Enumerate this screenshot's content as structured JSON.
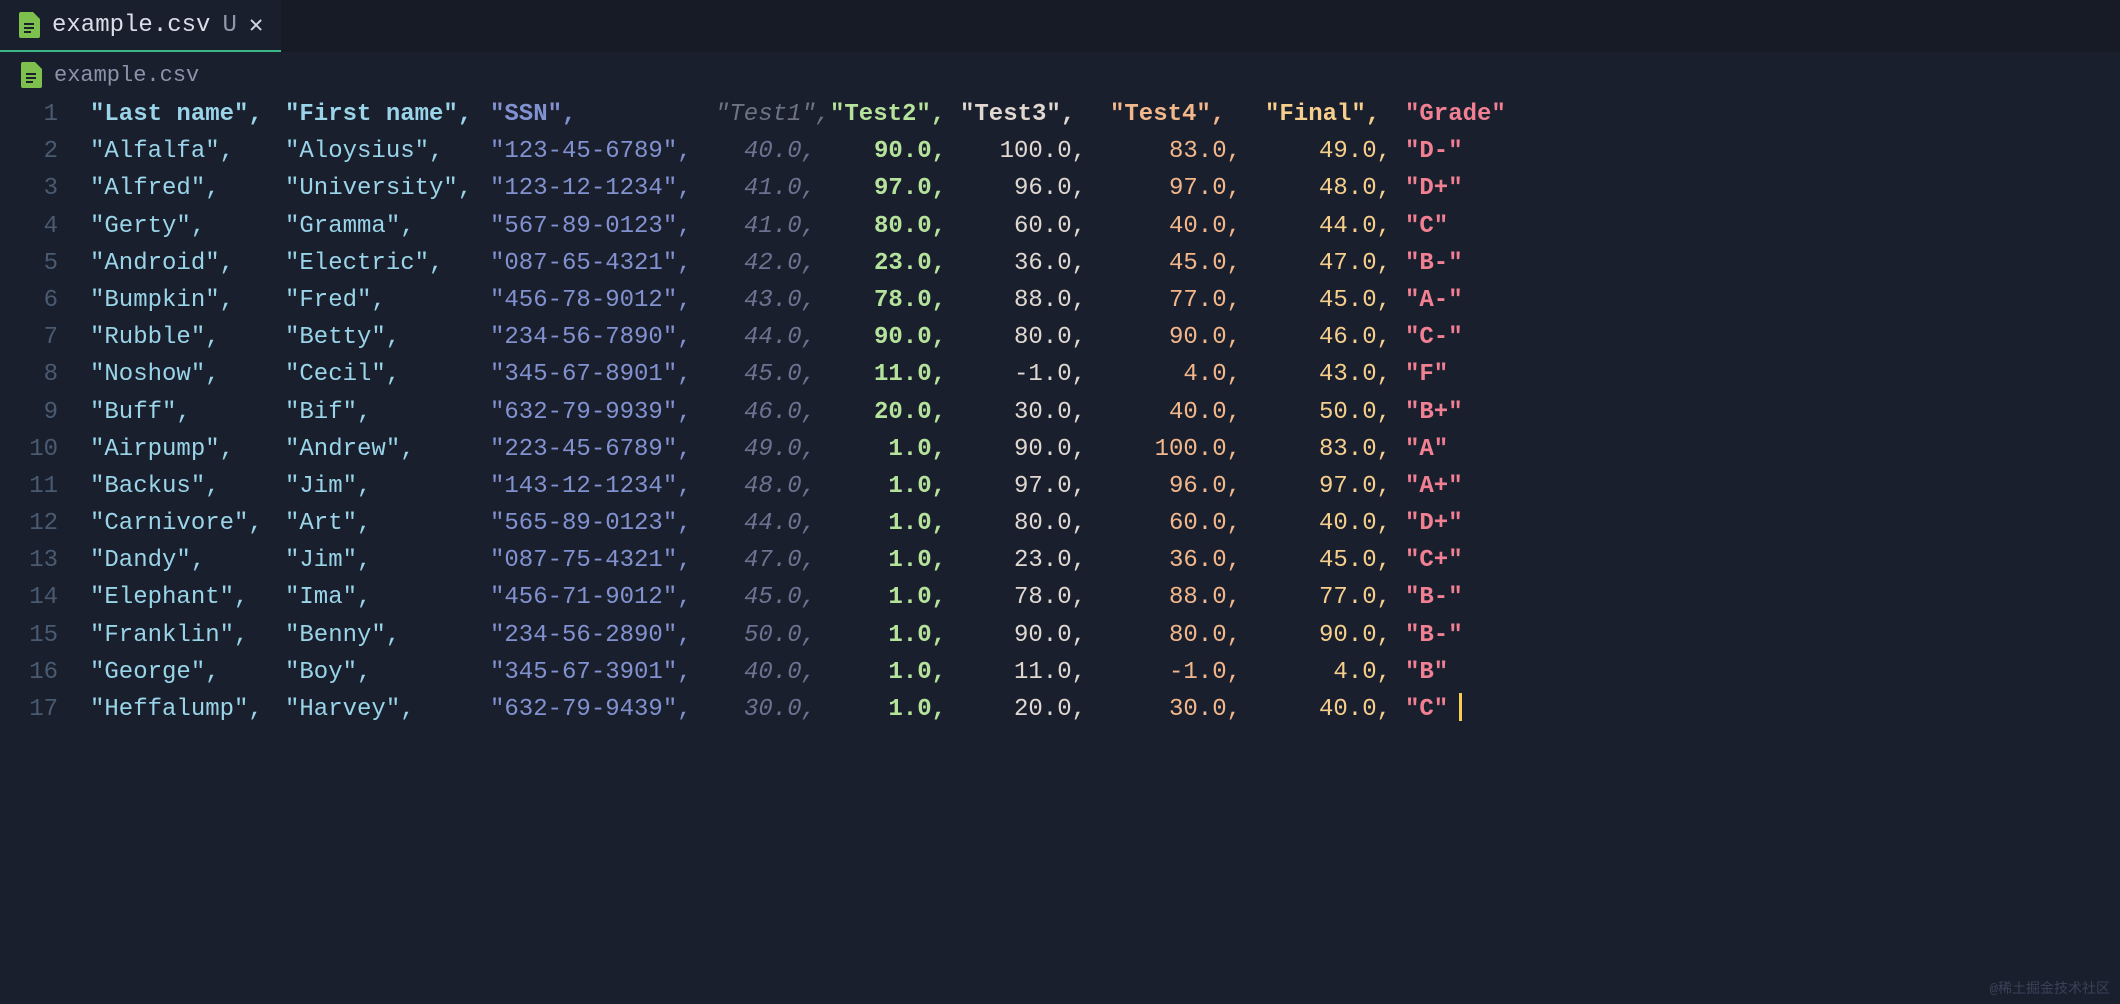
{
  "tab": {
    "title": "example.csv",
    "modified_indicator": "U",
    "close_glyph": "✕"
  },
  "breadcrumb": {
    "file": "example.csv"
  },
  "columns": [
    {
      "label": "\"Last name\",",
      "class": "c1",
      "w": "w1"
    },
    {
      "label": "\"First name\",",
      "class": "c2",
      "w": "w2"
    },
    {
      "label": "\"SSN\",",
      "class": "c3",
      "w": "w3"
    },
    {
      "label": "\"Test1\",",
      "class": "c4h",
      "w": "wh4"
    },
    {
      "label": "\"Test2\",",
      "class": "c5",
      "w": "wh5"
    },
    {
      "label": "\"Test3\",",
      "class": "c6",
      "w": "wh6"
    },
    {
      "label": "\"Test4\",",
      "class": "c7",
      "w": "wh7"
    },
    {
      "label": "\"Final\",",
      "class": "c8",
      "w": "wh8"
    },
    {
      "label": "\"Grade\"",
      "class": "c9",
      "w": "w9"
    }
  ],
  "rows": [
    {
      "last": "\"Alfalfa\",",
      "first": "\"Aloysius\",",
      "ssn": "\"123-45-6789\",",
      "t1": "40.0,",
      "t2": "90.0,",
      "t3": "100.0,",
      "t4": "83.0,",
      "fin": "49.0,",
      "gr": "\"D-\""
    },
    {
      "last": "\"Alfred\",",
      "first": "\"University\",",
      "ssn": "\"123-12-1234\",",
      "t1": "41.0,",
      "t2": "97.0,",
      "t3": "96.0,",
      "t4": "97.0,",
      "fin": "48.0,",
      "gr": "\"D+\""
    },
    {
      "last": "\"Gerty\",",
      "first": "\"Gramma\",",
      "ssn": "\"567-89-0123\",",
      "t1": "41.0,",
      "t2": "80.0,",
      "t3": "60.0,",
      "t4": "40.0,",
      "fin": "44.0,",
      "gr": "\"C\""
    },
    {
      "last": "\"Android\",",
      "first": "\"Electric\",",
      "ssn": "\"087-65-4321\",",
      "t1": "42.0,",
      "t2": "23.0,",
      "t3": "36.0,",
      "t4": "45.0,",
      "fin": "47.0,",
      "gr": "\"B-\""
    },
    {
      "last": "\"Bumpkin\",",
      "first": "\"Fred\",",
      "ssn": "\"456-78-9012\",",
      "t1": "43.0,",
      "t2": "78.0,",
      "t3": "88.0,",
      "t4": "77.0,",
      "fin": "45.0,",
      "gr": "\"A-\""
    },
    {
      "last": "\"Rubble\",",
      "first": "\"Betty\",",
      "ssn": "\"234-56-7890\",",
      "t1": "44.0,",
      "t2": "90.0,",
      "t3": "80.0,",
      "t4": "90.0,",
      "fin": "46.0,",
      "gr": "\"C-\""
    },
    {
      "last": "\"Noshow\",",
      "first": "\"Cecil\",",
      "ssn": "\"345-67-8901\",",
      "t1": "45.0,",
      "t2": "11.0,",
      "t3": "-1.0,",
      "t4": "4.0,",
      "fin": "43.0,",
      "gr": "\"F\""
    },
    {
      "last": "\"Buff\",",
      "first": "\"Bif\",",
      "ssn": "\"632-79-9939\",",
      "t1": "46.0,",
      "t2": "20.0,",
      "t3": "30.0,",
      "t4": "40.0,",
      "fin": "50.0,",
      "gr": "\"B+\""
    },
    {
      "last": "\"Airpump\",",
      "first": "\"Andrew\",",
      "ssn": "\"223-45-6789\",",
      "t1": "49.0,",
      "t2": "1.0,",
      "t3": "90.0,",
      "t4": "100.0,",
      "fin": "83.0,",
      "gr": "\"A\""
    },
    {
      "last": "\"Backus\",",
      "first": "\"Jim\",",
      "ssn": "\"143-12-1234\",",
      "t1": "48.0,",
      "t2": "1.0,",
      "t3": "97.0,",
      "t4": "96.0,",
      "fin": "97.0,",
      "gr": "\"A+\""
    },
    {
      "last": "\"Carnivore\",",
      "first": "\"Art\",",
      "ssn": "\"565-89-0123\",",
      "t1": "44.0,",
      "t2": "1.0,",
      "t3": "80.0,",
      "t4": "60.0,",
      "fin": "40.0,",
      "gr": "\"D+\""
    },
    {
      "last": "\"Dandy\",",
      "first": "\"Jim\",",
      "ssn": "\"087-75-4321\",",
      "t1": "47.0,",
      "t2": "1.0,",
      "t3": "23.0,",
      "t4": "36.0,",
      "fin": "45.0,",
      "gr": "\"C+\""
    },
    {
      "last": "\"Elephant\",",
      "first": "\"Ima\",",
      "ssn": "\"456-71-9012\",",
      "t1": "45.0,",
      "t2": "1.0,",
      "t3": "78.0,",
      "t4": "88.0,",
      "fin": "77.0,",
      "gr": "\"B-\""
    },
    {
      "last": "\"Franklin\",",
      "first": "\"Benny\",",
      "ssn": "\"234-56-2890\",",
      "t1": "50.0,",
      "t2": "1.0,",
      "t3": "90.0,",
      "t4": "80.0,",
      "fin": "90.0,",
      "gr": "\"B-\""
    },
    {
      "last": "\"George\",",
      "first": "\"Boy\",",
      "ssn": "\"345-67-3901\",",
      "t1": "40.0,",
      "t2": "1.0,",
      "t3": "11.0,",
      "t4": "-1.0,",
      "fin": "4.0,",
      "gr": "\"B\""
    },
    {
      "last": "\"Heffalump\",",
      "first": "\"Harvey\",",
      "ssn": "\"632-79-9439\",",
      "t1": "30.0,",
      "t2": "1.0,",
      "t3": "20.0,",
      "t4": "30.0,",
      "fin": "40.0,",
      "gr": "\"C\"",
      "cursor": true
    }
  ],
  "watermark": "@稀土掘金技术社区"
}
